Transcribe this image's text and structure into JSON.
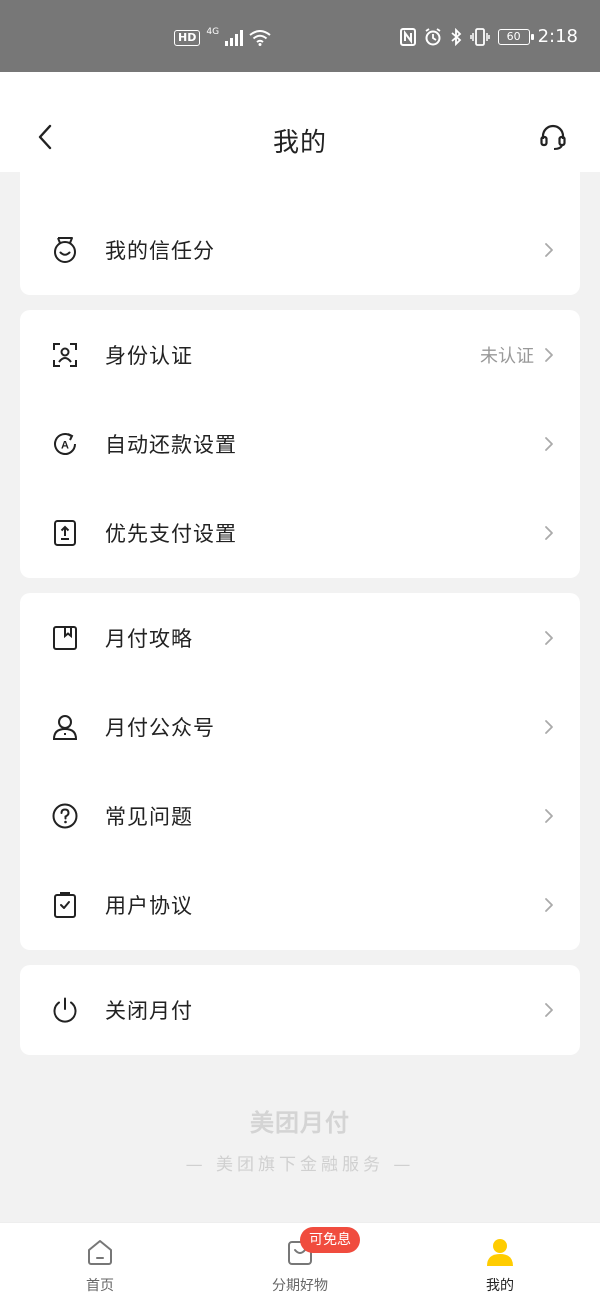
{
  "status_bar": {
    "hd": "HD",
    "network": "4G",
    "battery": "60",
    "time": "2:18"
  },
  "header": {
    "title": "我的"
  },
  "sections": [
    {
      "items": [
        {
          "label": "我的信任分",
          "icon": "trust-score-icon"
        }
      ]
    },
    {
      "items": [
        {
          "label": "身份认证",
          "value": "未认证",
          "icon": "id-verify-icon"
        },
        {
          "label": "自动还款设置",
          "icon": "auto-repay-icon"
        },
        {
          "label": "优先支付设置",
          "icon": "priority-pay-icon"
        }
      ]
    },
    {
      "items": [
        {
          "label": "月付攻略",
          "icon": "guide-book-icon"
        },
        {
          "label": "月付公众号",
          "icon": "official-account-icon"
        },
        {
          "label": "常见问题",
          "icon": "question-icon"
        },
        {
          "label": "用户协议",
          "icon": "agreement-icon"
        }
      ]
    },
    {
      "items": [
        {
          "label": "关闭月付",
          "icon": "power-icon"
        }
      ]
    }
  ],
  "footer": {
    "brand": "美团月付",
    "subtitle": "— 美团旗下金融服务 —"
  },
  "bottom_nav": {
    "items": [
      {
        "label": "首页",
        "icon": "home-icon"
      },
      {
        "label": "分期好物",
        "icon": "goods-icon",
        "badge": "可免息"
      },
      {
        "label": "我的",
        "icon": "user-icon",
        "active": true
      }
    ]
  },
  "colors": {
    "accent": "#ffcc00",
    "badge": "#f04c3e",
    "background": "#f2f2f2",
    "status_bar": "#777777"
  }
}
